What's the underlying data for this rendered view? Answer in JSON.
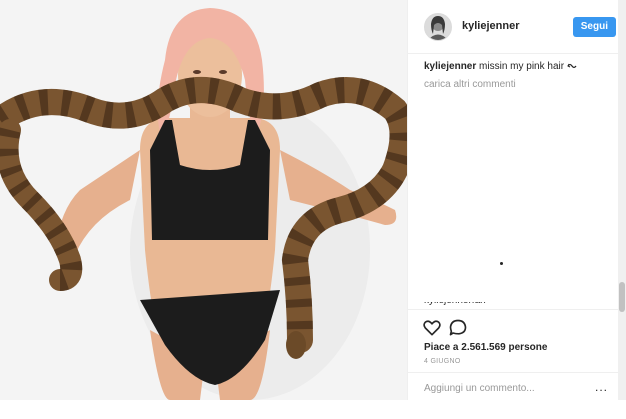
{
  "post": {
    "author": {
      "username": "kyliejenner",
      "avatar": "avatar"
    },
    "follow_label": "Segui",
    "caption": {
      "username": "kyliejenner",
      "text": "missin my pink hair ",
      "emoji_icon": "wavy-symbol-icon"
    },
    "load_more_label": "carica altri commenti",
    "likes_text": "Piace a 2.561.569 persone",
    "date_text": "4 GIUGNO",
    "actions": {
      "like_icon": "heart-icon",
      "comment_icon": "comment-icon"
    },
    "comment_placeholder": "Aggiungi un commento...",
    "more_label": "..."
  },
  "photo": {
    "background_color": "#f3f3f3",
    "hair_color": "#f2b8a8",
    "swimsuit_color": "#1c1c1c",
    "skin_color": "#e8b896",
    "snake_color": "#7a5530"
  },
  "colors": {
    "accent": "#3897f0",
    "muted_text": "#999999",
    "text": "#262626",
    "divider": "#efefef"
  }
}
